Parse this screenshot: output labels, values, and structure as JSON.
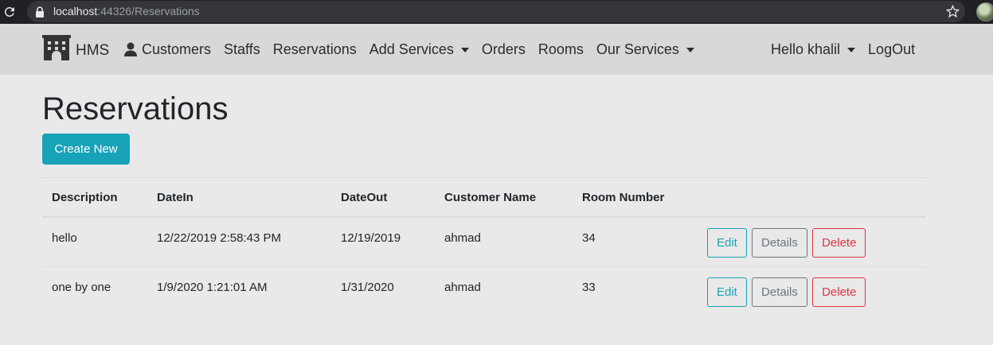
{
  "browser": {
    "url_host": "localhost",
    "url_path": ":44326/Reservations"
  },
  "navbar": {
    "brand": "HMS",
    "items": [
      {
        "label": "Customers",
        "icon": "user-icon"
      },
      {
        "label": "Staffs"
      },
      {
        "label": "Reservations"
      },
      {
        "label": "Add Services",
        "dropdown": true
      },
      {
        "label": "Orders"
      },
      {
        "label": "Rooms"
      },
      {
        "label": "Our Services",
        "dropdown": true
      }
    ],
    "greeting": "Hello khalil",
    "logout": "LogOut"
  },
  "page": {
    "title": "Reservations",
    "create_label": "Create New"
  },
  "table": {
    "headers": [
      "Description",
      "DateIn",
      "DateOut",
      "Customer Name",
      "Room Number"
    ],
    "rows": [
      {
        "description": "hello",
        "date_in": "12/22/2019 2:58:43 PM",
        "date_out": "12/19/2019",
        "customer": "ahmad",
        "room": "34"
      },
      {
        "description": "one by one",
        "date_in": "1/9/2020 1:21:01 AM",
        "date_out": "1/31/2020",
        "customer": "ahmad",
        "room": "33"
      }
    ],
    "actions": {
      "edit": "Edit",
      "details": "Details",
      "delete": "Delete"
    }
  },
  "colors": {
    "accent": "#17a2b8",
    "secondary": "#6c757d",
    "danger": "#dc3545",
    "navbar_bg": "#d8d8d8",
    "page_bg": "#e9e9e9"
  }
}
